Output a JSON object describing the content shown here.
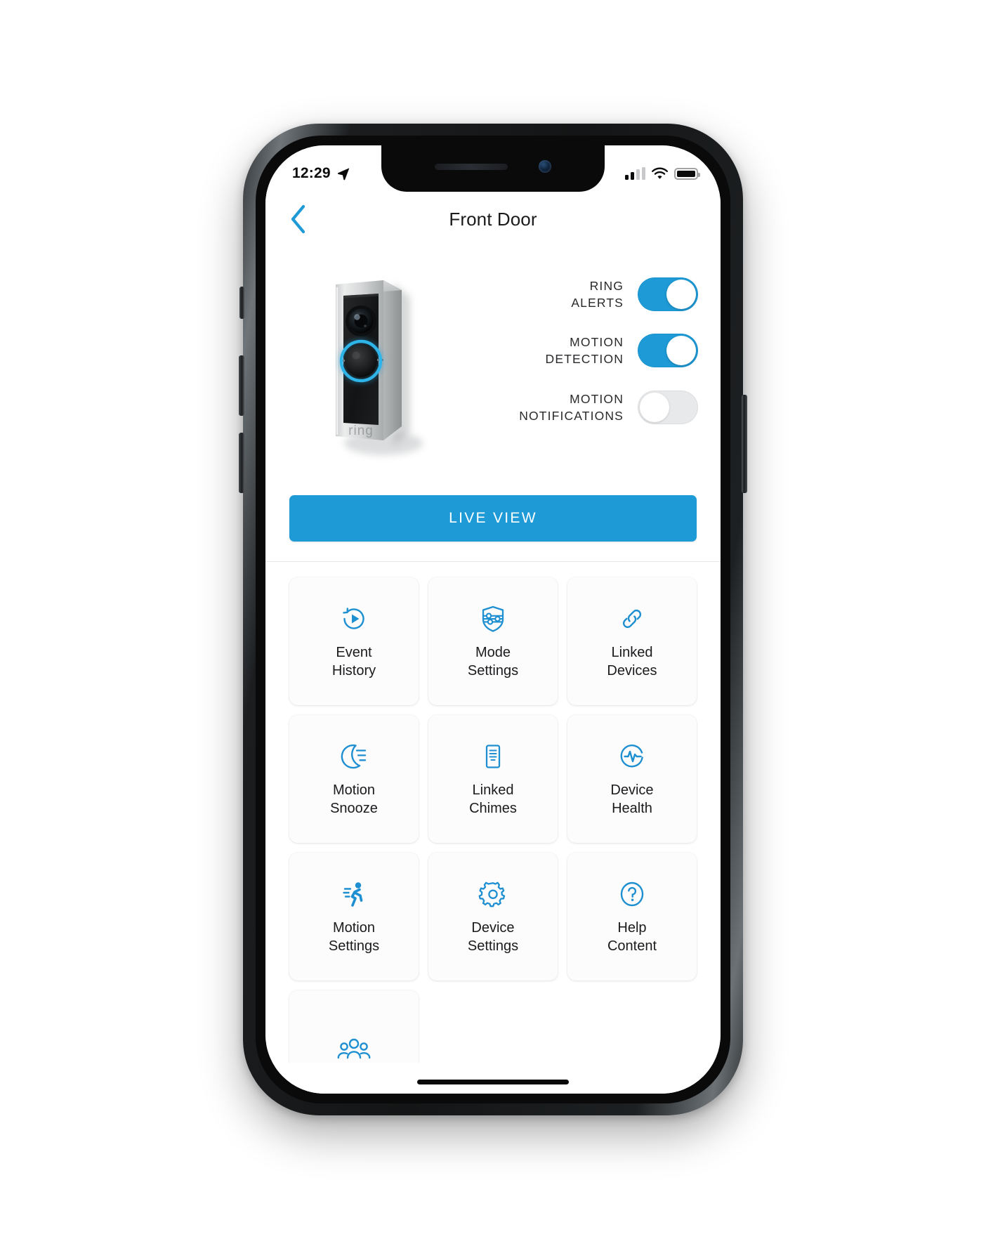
{
  "status_bar": {
    "time": "12:29",
    "location_icon": "location-arrow-icon",
    "signal_icon": "cellular-signal-icon",
    "wifi_icon": "wifi-icon",
    "battery_icon": "battery-full-icon"
  },
  "nav": {
    "back_icon": "chevron-left-icon",
    "title": "Front Door"
  },
  "device": {
    "image_name": "ring-video-doorbell-pro",
    "brand_mark": "ring"
  },
  "toggles": [
    {
      "label": "RING\nALERTS",
      "state": "on",
      "name": "ring-alerts-toggle"
    },
    {
      "label": "MOTION\nDETECTION",
      "state": "on",
      "name": "motion-detection-toggle"
    },
    {
      "label": "MOTION\nNOTIFICATIONS",
      "state": "off",
      "name": "motion-notifications-toggle"
    }
  ],
  "live_view": {
    "label": "LIVE VIEW"
  },
  "tiles": [
    {
      "label": "Event\nHistory",
      "icon": "history-play-icon",
      "name": "tile-event-history"
    },
    {
      "label": "Mode\nSettings",
      "icon": "shield-sliders-icon",
      "name": "tile-mode-settings"
    },
    {
      "label": "Linked\nDevices",
      "icon": "chain-link-icon",
      "name": "tile-linked-devices"
    },
    {
      "label": "Motion\nSnooze",
      "icon": "moon-lines-icon",
      "name": "tile-motion-snooze"
    },
    {
      "label": "Linked\nChimes",
      "icon": "document-lines-icon",
      "name": "tile-linked-chimes"
    },
    {
      "label": "Device\nHealth",
      "icon": "heartbeat-circle-icon",
      "name": "tile-device-health"
    },
    {
      "label": "Motion\nSettings",
      "icon": "running-person-icon",
      "name": "tile-motion-settings"
    },
    {
      "label": "Device\nSettings",
      "icon": "gear-icon",
      "name": "tile-device-settings"
    },
    {
      "label": "Help\nContent",
      "icon": "question-circle-icon",
      "name": "tile-help-content"
    },
    {
      "label": "",
      "icon": "people-group-icon",
      "name": "tile-shared-users"
    }
  ],
  "colors": {
    "accent": "#1e9ad6",
    "text": "#1b1b1d",
    "toggle_off": "#e8e9eb",
    "tile_bg": "#fcfcfd",
    "divider": "#e6e7e9"
  }
}
